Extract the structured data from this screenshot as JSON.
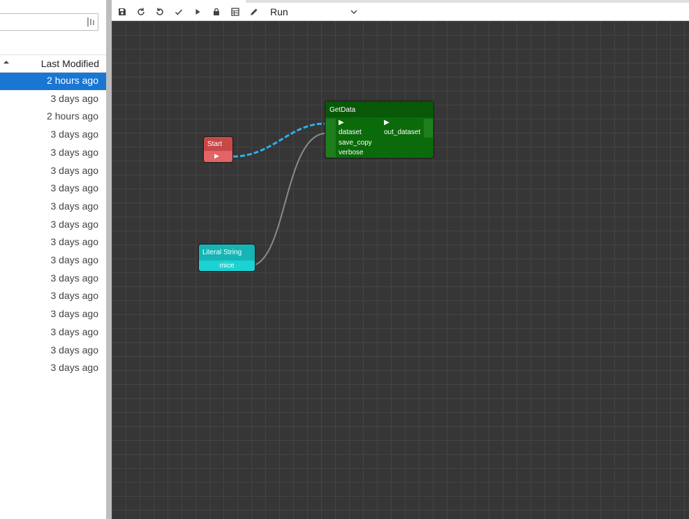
{
  "file_browser": {
    "column_header": "Last Modified",
    "rows": [
      {
        "modified": "2 hours ago",
        "selected": true
      },
      {
        "modified": "3 days ago",
        "selected": false
      },
      {
        "modified": "2 hours ago",
        "selected": false
      },
      {
        "modified": "3 days ago",
        "selected": false
      },
      {
        "modified": "3 days ago",
        "selected": false
      },
      {
        "modified": "3 days ago",
        "selected": false
      },
      {
        "modified": "3 days ago",
        "selected": false
      },
      {
        "modified": "3 days ago",
        "selected": false
      },
      {
        "modified": "3 days ago",
        "selected": false
      },
      {
        "modified": "3 days ago",
        "selected": false
      },
      {
        "modified": "3 days ago",
        "selected": false
      },
      {
        "modified": "3 days ago",
        "selected": false
      },
      {
        "modified": "3 days ago",
        "selected": false
      },
      {
        "modified": "3 days ago",
        "selected": false
      },
      {
        "modified": "3 days ago",
        "selected": false
      },
      {
        "modified": "3 days ago",
        "selected": false
      },
      {
        "modified": "3 days ago",
        "selected": false
      }
    ]
  },
  "toolbar": {
    "buttons": [
      "save-icon",
      "reload-icon",
      "undo-icon",
      "check-icon",
      "run-icon",
      "lock-icon",
      "table-icon",
      "pencil-icon"
    ],
    "run_mode": "Run"
  },
  "canvas": {
    "nodes": {
      "start": {
        "title": "Start",
        "out_port": "▶",
        "color": "#c84848"
      },
      "literal": {
        "title": "Literal String",
        "value": "mice",
        "color": "#16b5b5"
      },
      "getdata": {
        "title": "GetData",
        "color": "#0b6b0b",
        "inputs": [
          "▶",
          "dataset",
          "save_copy",
          "verbose"
        ],
        "outputs": [
          "▶",
          "out_dataset"
        ]
      }
    },
    "link_colors": {
      "flow": "#2eb0e8",
      "data": "#8a8a8a"
    }
  }
}
